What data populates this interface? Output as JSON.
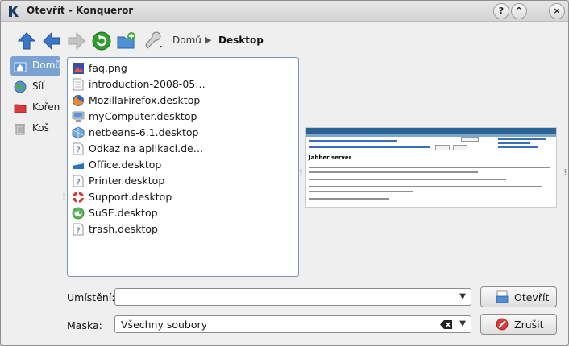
{
  "window": {
    "title": "Otevřít - Konqueror"
  },
  "titlebar_buttons": {
    "help": "?",
    "minimize": "^",
    "close": "×"
  },
  "breadcrumb": {
    "home": "Domů",
    "separator": "▶",
    "current": "Desktop"
  },
  "places": [
    {
      "label": "Domů",
      "icon": "home-icon",
      "selected": true
    },
    {
      "label": "Síť",
      "icon": "network-icon",
      "selected": false
    },
    {
      "label": "Kořen",
      "icon": "root-folder-icon",
      "selected": false
    },
    {
      "label": "Koš",
      "icon": "trash-icon",
      "selected": false
    }
  ],
  "files": [
    {
      "name": "faq.png",
      "icon": "image-file-icon"
    },
    {
      "name": "introduction-2008-05…",
      "icon": "document-file-icon"
    },
    {
      "name": "MozillaFirefox.desktop",
      "icon": "firefox-icon"
    },
    {
      "name": "myComputer.desktop",
      "icon": "computer-icon"
    },
    {
      "name": "netbeans-6.1.desktop",
      "icon": "netbeans-icon"
    },
    {
      "name": "Odkaz na aplikaci.de…",
      "icon": "unknown-file-icon"
    },
    {
      "name": "Office.desktop",
      "icon": "office-icon"
    },
    {
      "name": "Printer.desktop",
      "icon": "unknown-file-icon"
    },
    {
      "name": "Support.desktop",
      "icon": "support-icon"
    },
    {
      "name": "SuSE.desktop",
      "icon": "suse-icon"
    },
    {
      "name": "trash.desktop",
      "icon": "unknown-file-icon"
    }
  ],
  "preview": {
    "heading": "Jabber server"
  },
  "location": {
    "label": "Umístění:",
    "value": ""
  },
  "filter": {
    "label": "Maska:",
    "value": "Všechny soubory"
  },
  "buttons": {
    "open": "Otevřít",
    "cancel": "Zrušit"
  },
  "colors": {
    "selection": "#7aa3d4",
    "list_border": "#7a95b5",
    "accent_blue": "#2f6fc0",
    "accent_green": "#2f9e2f"
  }
}
